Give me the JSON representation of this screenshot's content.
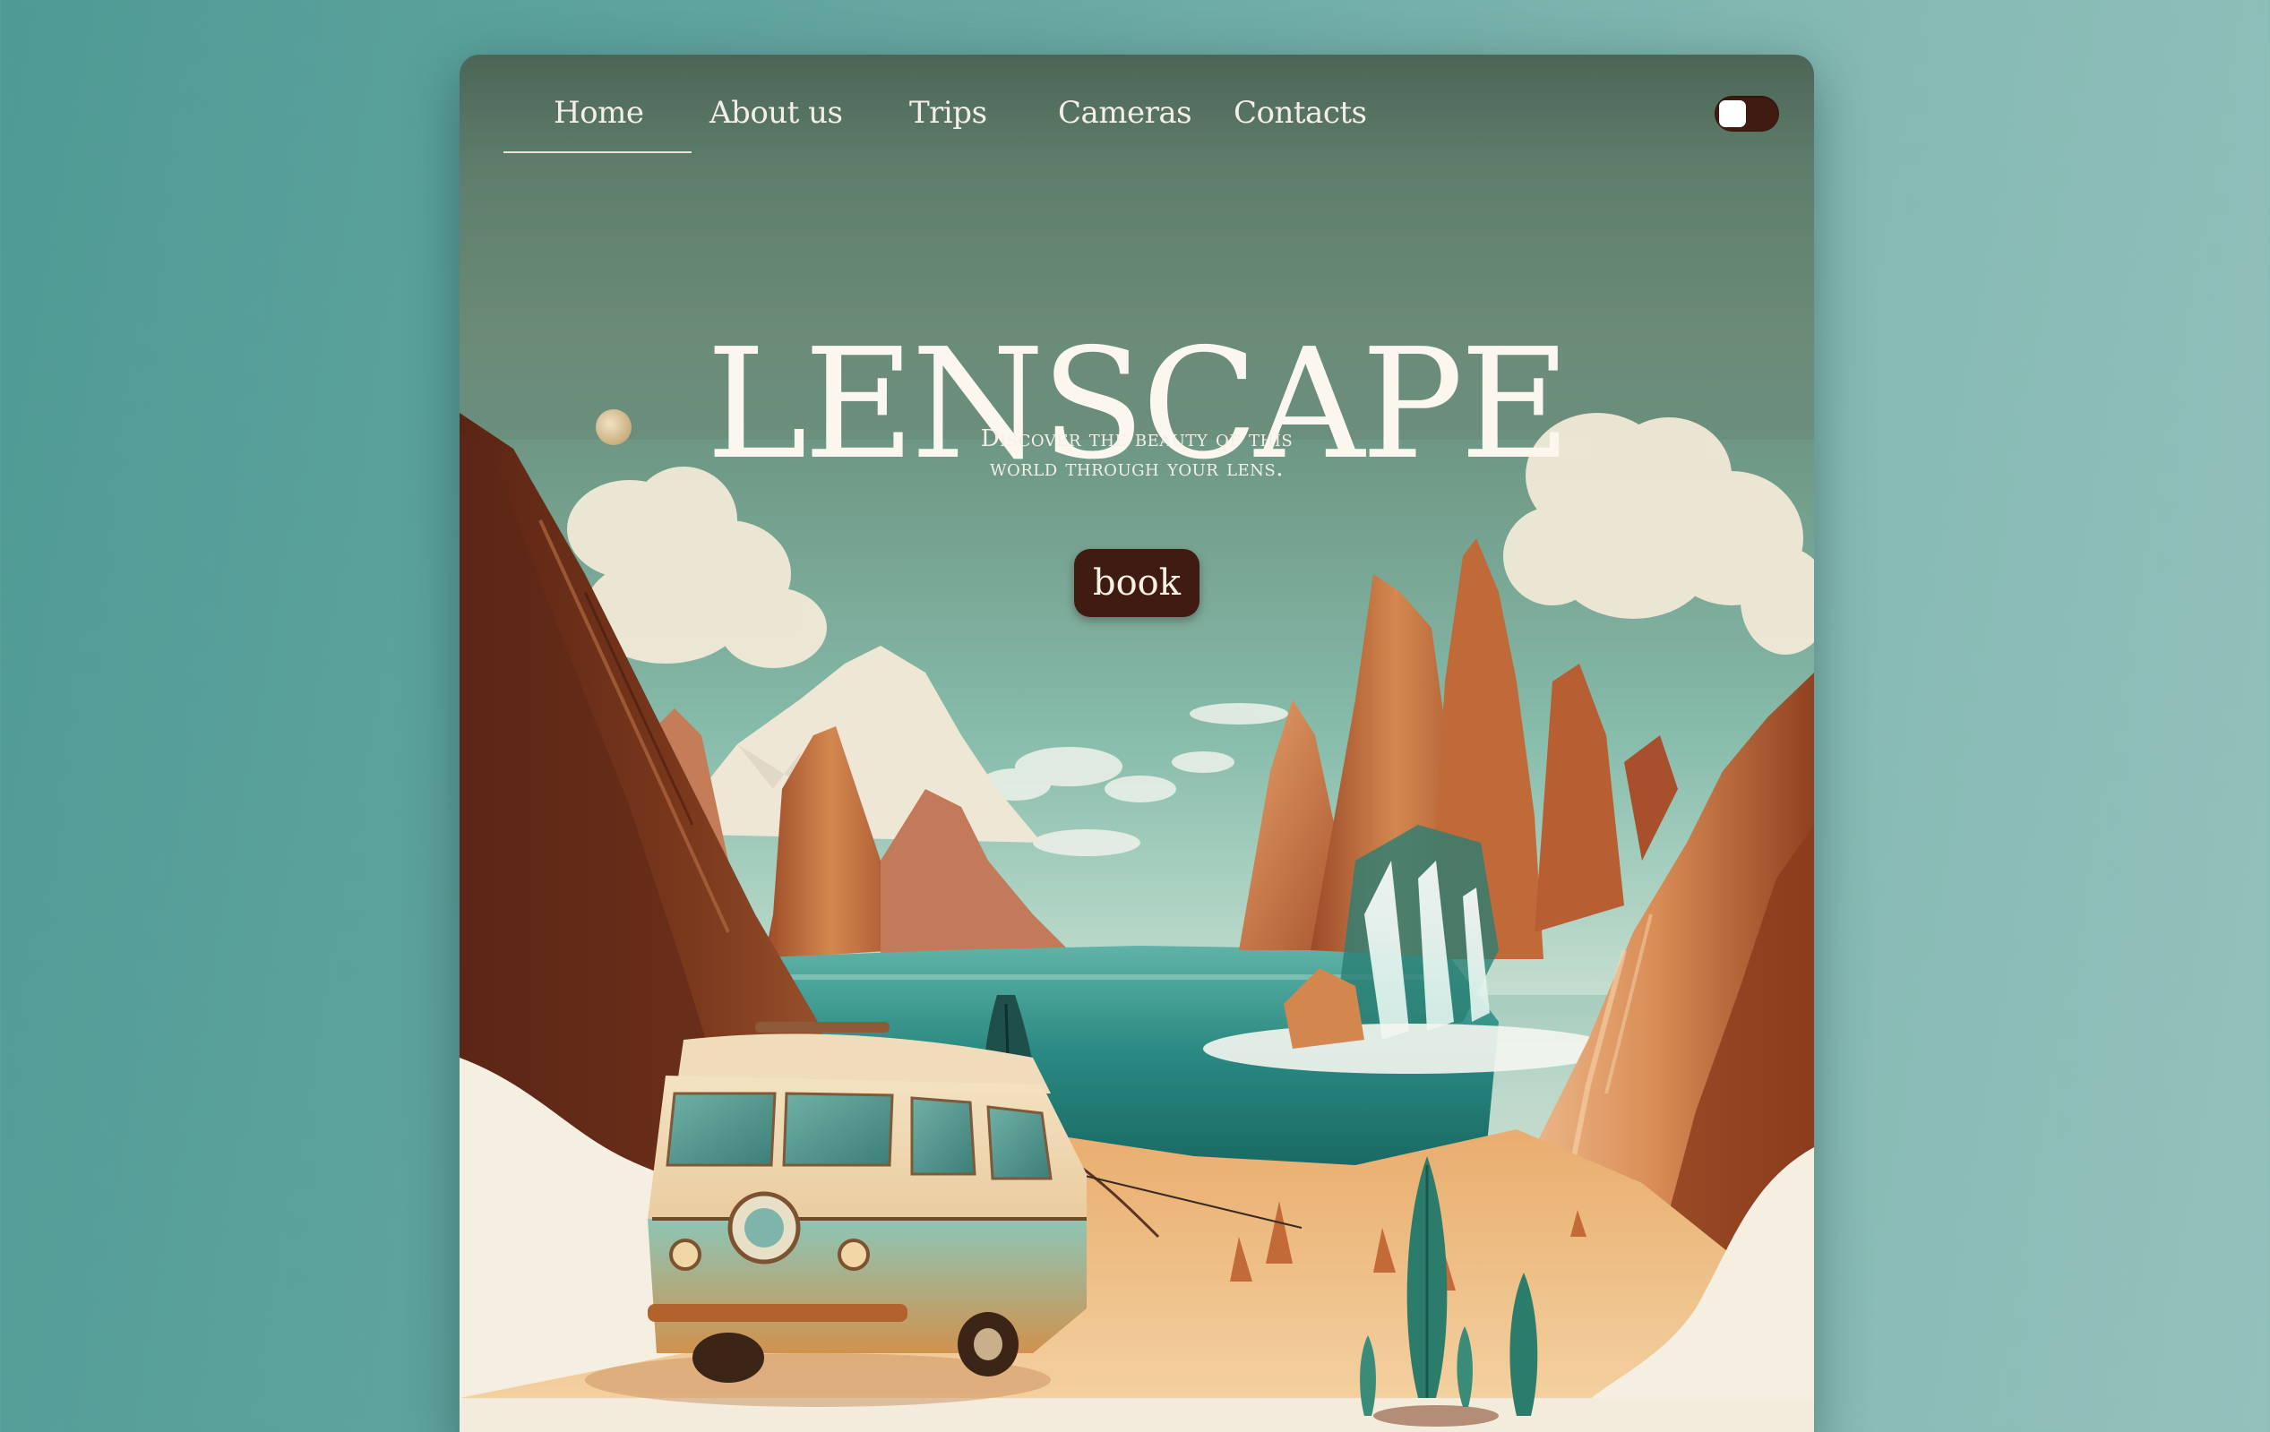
{
  "nav": {
    "items": [
      {
        "label": "Home",
        "active": true
      },
      {
        "label": "About us",
        "active": false
      },
      {
        "label": "Trips",
        "active": false
      },
      {
        "label": "Cameras",
        "active": false
      },
      {
        "label": "Contacts",
        "active": false
      }
    ],
    "theme_toggle": {
      "state": "off"
    }
  },
  "hero": {
    "logo": "LENSCAPE",
    "tagline_line1": "Discover the beauty of this",
    "tagline_line2": "world through your lens.",
    "cta_label": "book"
  },
  "colors": {
    "page_background": "#67a8a2",
    "header_green": "#5e7d6c",
    "button_brown": "#3f1b12",
    "text_cream": "#f4efe6",
    "sand": "#e6b27a",
    "lake_teal": "#1f7a74",
    "rock_orange": "#c8703e"
  },
  "illustration": {
    "subject": "retro camper van in a desert canyon with waterfall and lake",
    "icons": [
      "moon-icon",
      "camper-van-illustration",
      "waterfall-illustration",
      "cypress-tree-illustration"
    ]
  }
}
